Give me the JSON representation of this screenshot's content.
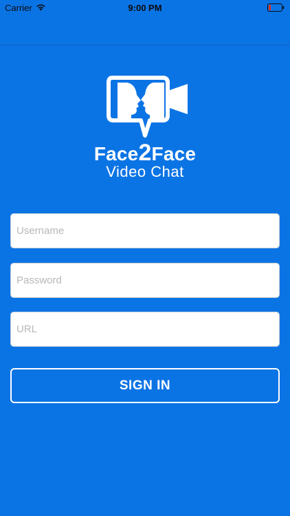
{
  "status_bar": {
    "carrier": "Carrier",
    "time": "9:00 PM",
    "wifi_icon": "wifi-icon",
    "battery_icon": "battery-icon"
  },
  "logo": {
    "title_prefix": "Face",
    "title_number": "2",
    "title_suffix": "Face",
    "subtitle": "Video Chat",
    "icon": "video-chat-faces-icon"
  },
  "form": {
    "username": {
      "placeholder": "Username",
      "value": ""
    },
    "password": {
      "placeholder": "Password",
      "value": ""
    },
    "url": {
      "placeholder": "URL",
      "value": ""
    },
    "signin_label": "SIGN IN"
  },
  "colors": {
    "background": "#0b74e5",
    "text": "#ffffff",
    "battery_low": "#e0301e"
  }
}
